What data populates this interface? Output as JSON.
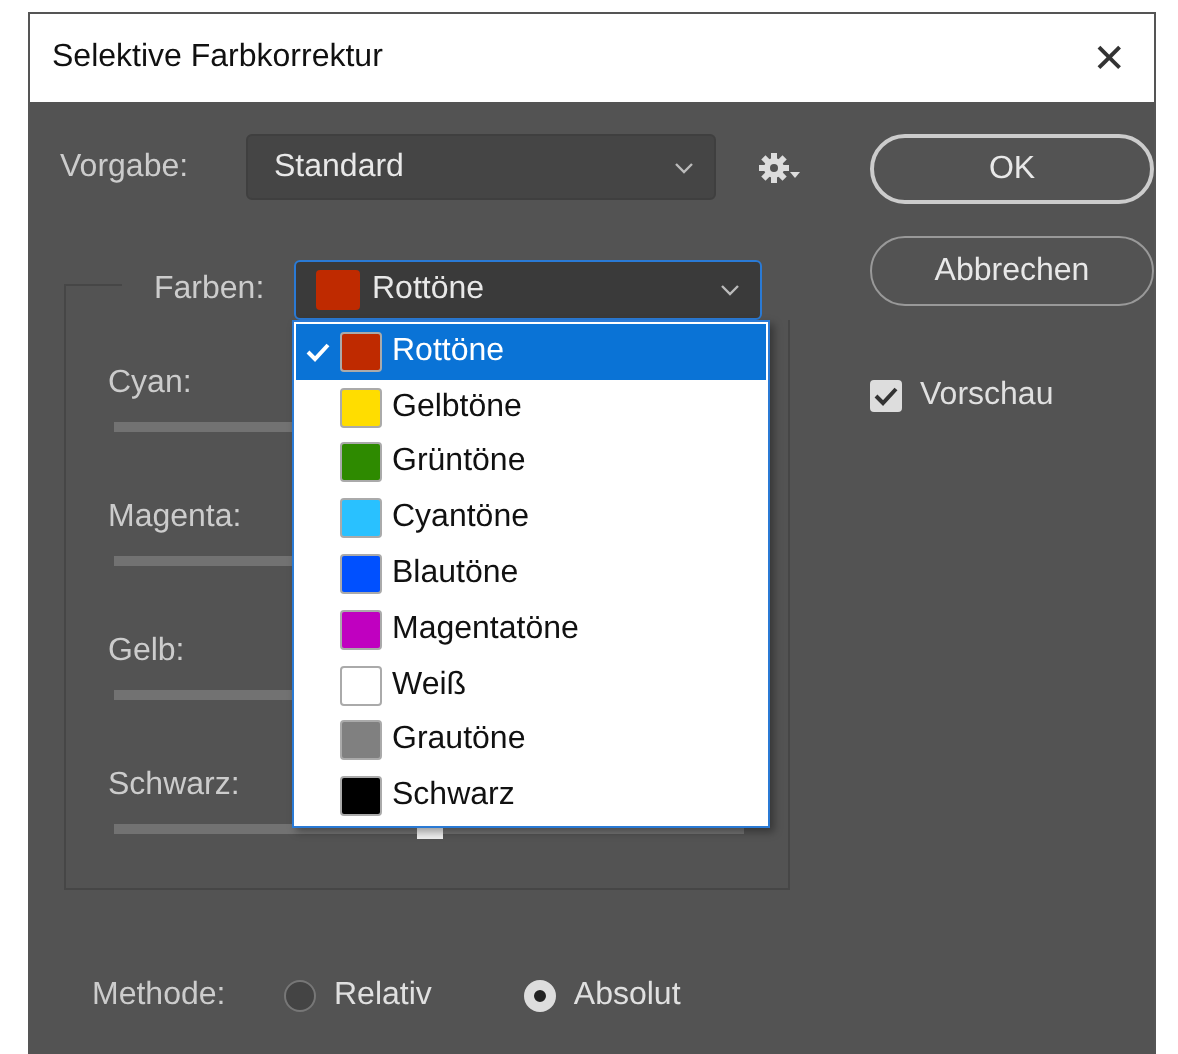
{
  "window": {
    "title": "Selektive Farbkorrektur",
    "close": "✕"
  },
  "preset": {
    "label": "Vorgabe:",
    "value": "Standard"
  },
  "buttons": [
    {
      "label": "OK",
      "kind": "default"
    },
    {
      "label": "Abbrechen",
      "kind": "normal"
    }
  ],
  "preview": {
    "label": "Vorschau",
    "checked": true
  },
  "colors": {
    "label": "Farben:",
    "value": "Rottöne",
    "color": "#bf2a00",
    "expanded": true,
    "options": [
      {
        "label": "Rottöne",
        "color": "#bf2a00",
        "selected": true
      },
      {
        "label": "Gelbtöne",
        "color": "#ffdd00",
        "selected": false
      },
      {
        "label": "Grüntöne",
        "color": "#2e8a00",
        "selected": false
      },
      {
        "label": "Cyantöne",
        "color": "#29c1ff",
        "selected": false
      },
      {
        "label": "Blautöne",
        "color": "#0050ff",
        "selected": false
      },
      {
        "label": "Magentatöne",
        "color": "#c000c0",
        "selected": false
      },
      {
        "label": "Weiß",
        "color": "#ffffff",
        "selected": false
      },
      {
        "label": "Grautöne",
        "color": "#808080",
        "selected": false
      },
      {
        "label": "Schwarz",
        "color": "#000000",
        "selected": false
      }
    ]
  },
  "sliders": [
    {
      "label": "Cyan:"
    },
    {
      "label": "Magenta:"
    },
    {
      "label": "Gelb:"
    },
    {
      "label": "Schwarz:",
      "level": 0.5
    }
  ],
  "method": {
    "label": "Methode:",
    "options": [
      {
        "label": "Relativ",
        "selected": false
      },
      {
        "label": "Absolut",
        "selected": true
      }
    ]
  }
}
